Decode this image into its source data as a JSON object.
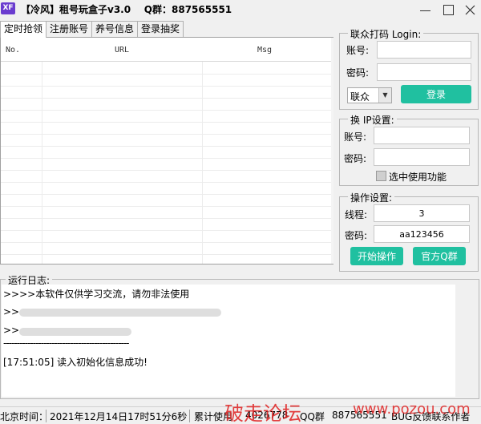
{
  "window": {
    "icon_text": "XF",
    "title": "【冷风】租号玩盒子v3.0    Q群：887565551"
  },
  "tabs": [
    {
      "label": "定时抢领",
      "active": true
    },
    {
      "label": "注册账号",
      "active": false
    },
    {
      "label": "养号信息",
      "active": false
    },
    {
      "label": "登录抽奖",
      "active": false
    }
  ],
  "table": {
    "columns": [
      "No.",
      "URL",
      "Msg"
    ],
    "rows": []
  },
  "login_group": {
    "title": "联众打码 Login:",
    "account_label": "账号:",
    "account_value": "",
    "password_label": "密码:",
    "password_value": "",
    "select_value": "联众",
    "login_button": "登录"
  },
  "ip_group": {
    "title": "换 IP设置:",
    "account_label": "账号:",
    "account_value": "",
    "password_label": "密码:",
    "password_value": "",
    "checkbox_label": "选中使用功能",
    "checkbox_checked": false
  },
  "operation_group": {
    "title": "操作设置:",
    "threads_label": "线程:",
    "threads_value": "3",
    "password_label": "密码:",
    "password_value": "aa123456",
    "start_button": "开始操作",
    "group_button": "官方Q群"
  },
  "log": {
    "title": "运行日志:",
    "lines": [
      ">>>>本软件仅供学习交流，请勿非法使用",
      ">>",
      ">>",
      "-----------------------------------------------",
      "",
      "[17:51:05]  读入初始化信息成功!"
    ]
  },
  "status": {
    "time_label": "北京时间：",
    "time_value": "2021年12月14日17时51分6秒",
    "usage_label": "累计使用",
    "usage_value": "4026778",
    "qq_label": "QQ群",
    "qq_value": "887565551",
    "feedback": "BUG反馈联系作者"
  },
  "watermark": {
    "text": "破走论坛",
    "url": "www.pozou.com"
  }
}
